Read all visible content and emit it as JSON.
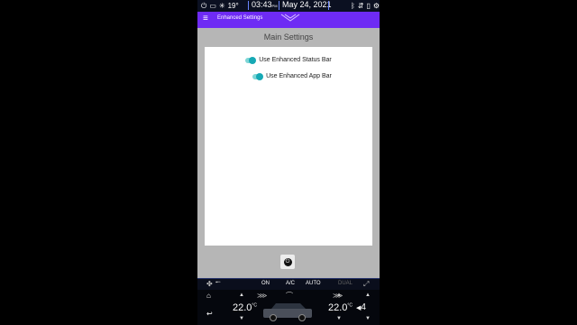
{
  "status": {
    "temperature": "19°",
    "time": "03:43",
    "time_suffix": "PM",
    "date": "May 24, 2021"
  },
  "appbar": {
    "title": "Enhanced Settings"
  },
  "main": {
    "title": "Main Settings",
    "settings": [
      {
        "label": "Use Enhanced Status Bar",
        "on": true
      },
      {
        "label": "Use Enhanced App Bar",
        "on": true
      }
    ]
  },
  "climate": {
    "on_label": "ON",
    "ac_label": "A/C",
    "auto_label": "AUTO",
    "dual_label": "DUAL",
    "left_temp": "22.0",
    "right_temp": "22.0",
    "temp_unit": "°C",
    "fan_level": "4"
  },
  "colors": {
    "appbar": "#6e2bf4",
    "toggle": "#16a9b5",
    "statusbar": "#0b1021"
  }
}
